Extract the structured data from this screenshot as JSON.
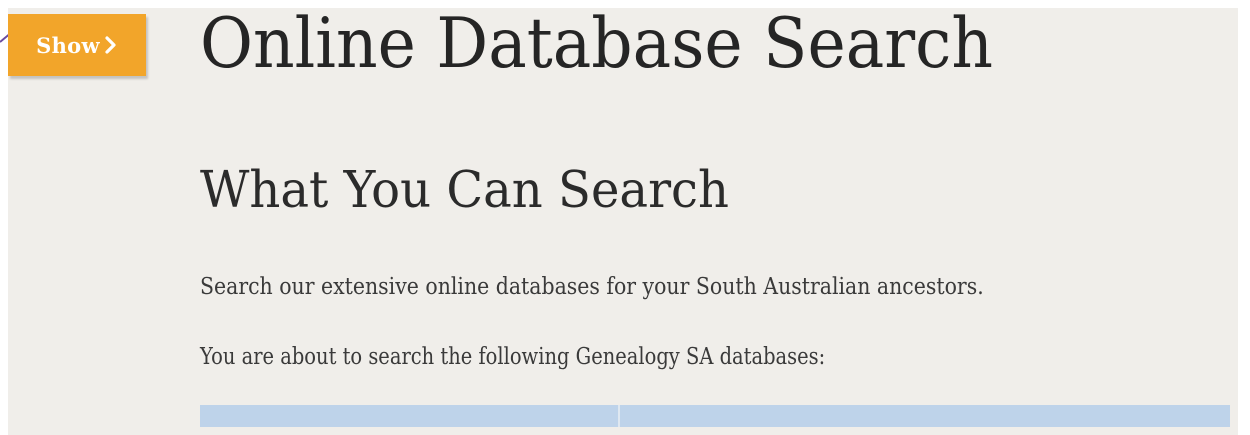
{
  "colors": {
    "accent": "#f2a52a",
    "background": "#f0eeea",
    "text": "#252525",
    "table_header": "#bed3ea"
  },
  "sidebar_toggle": {
    "label": "Show",
    "icon": "chevron-right-icon"
  },
  "main": {
    "title": "Online Database Search",
    "section_heading": "What You Can Search",
    "intro": "Search our extensive online databases for your South Australian ancestors.",
    "list_intro": "You are about to search the following Genealogy SA databases:"
  }
}
